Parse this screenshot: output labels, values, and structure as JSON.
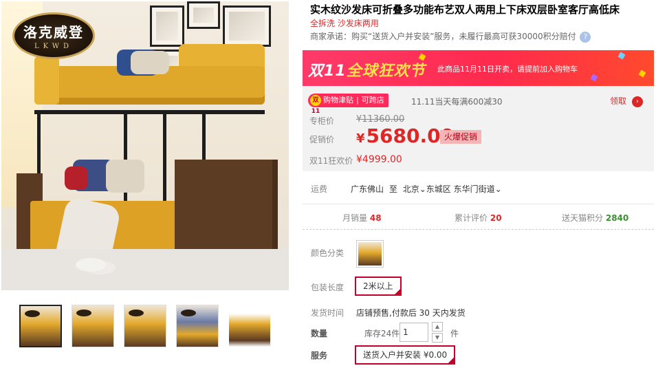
{
  "logo": {
    "cn": "洛克威登",
    "en": "LKWD"
  },
  "product": {
    "title": "实木纹沙发床可折叠多功能布艺双人两用上下床双层卧室客厅高低床",
    "subtitle": "全拆洗 沙发床两用",
    "promise": "商家承诺：购买“送货入户并安装”服务，未履行最高可获30000积分赔付",
    "promise_help_icon": "?"
  },
  "banner": {
    "prefix": "双11",
    "highlight": "全球狂欢节",
    "note": "此商品11月11日开卖，请提前加入购物车"
  },
  "coupon": {
    "badge": "双11",
    "tag_left": "购物津贴",
    "tag_right": "可跨店",
    "text": "11.11当天每满600减30",
    "get_label": "领取",
    "arrow_icon": "›"
  },
  "prices": {
    "orig_label": "专柜价",
    "orig_value": "¥11360.00",
    "cur_label": "促销价",
    "cur_currency": "¥",
    "cur_value": "5680.00",
    "hot_badge": "火爆促销",
    "d11_label": "双11狂欢价",
    "d11_value": "¥4999.00"
  },
  "shipping": {
    "label": "运费",
    "from": "广东佛山",
    "to_word": "至",
    "city": "北京",
    "district": "东城区",
    "street": "东华门街道",
    "chevron": "⌄"
  },
  "stats": {
    "monthly_label": "月销量",
    "monthly_value": "48",
    "reviews_label": "累计评价",
    "reviews_value": "20",
    "points_label": "送天猫积分",
    "points_value": "2840"
  },
  "options": {
    "color_label": "颜色分类",
    "length_label": "包装长度",
    "length_value": "2米以上",
    "ship_time_label": "发货时间",
    "ship_time_value": "店铺预售,付款后 30 天内发货",
    "qty_label": "数量",
    "stock": "库存24件",
    "qty_value": "1",
    "qty_unit": "件",
    "qty_up": "▲",
    "qty_down": "▼",
    "service_label": "服务",
    "service_value": "送货入户并安装 ¥0.00"
  },
  "colors": {
    "accent": "#dd2727",
    "banner": "#ff2a4d",
    "points": "#3a8f2e"
  }
}
